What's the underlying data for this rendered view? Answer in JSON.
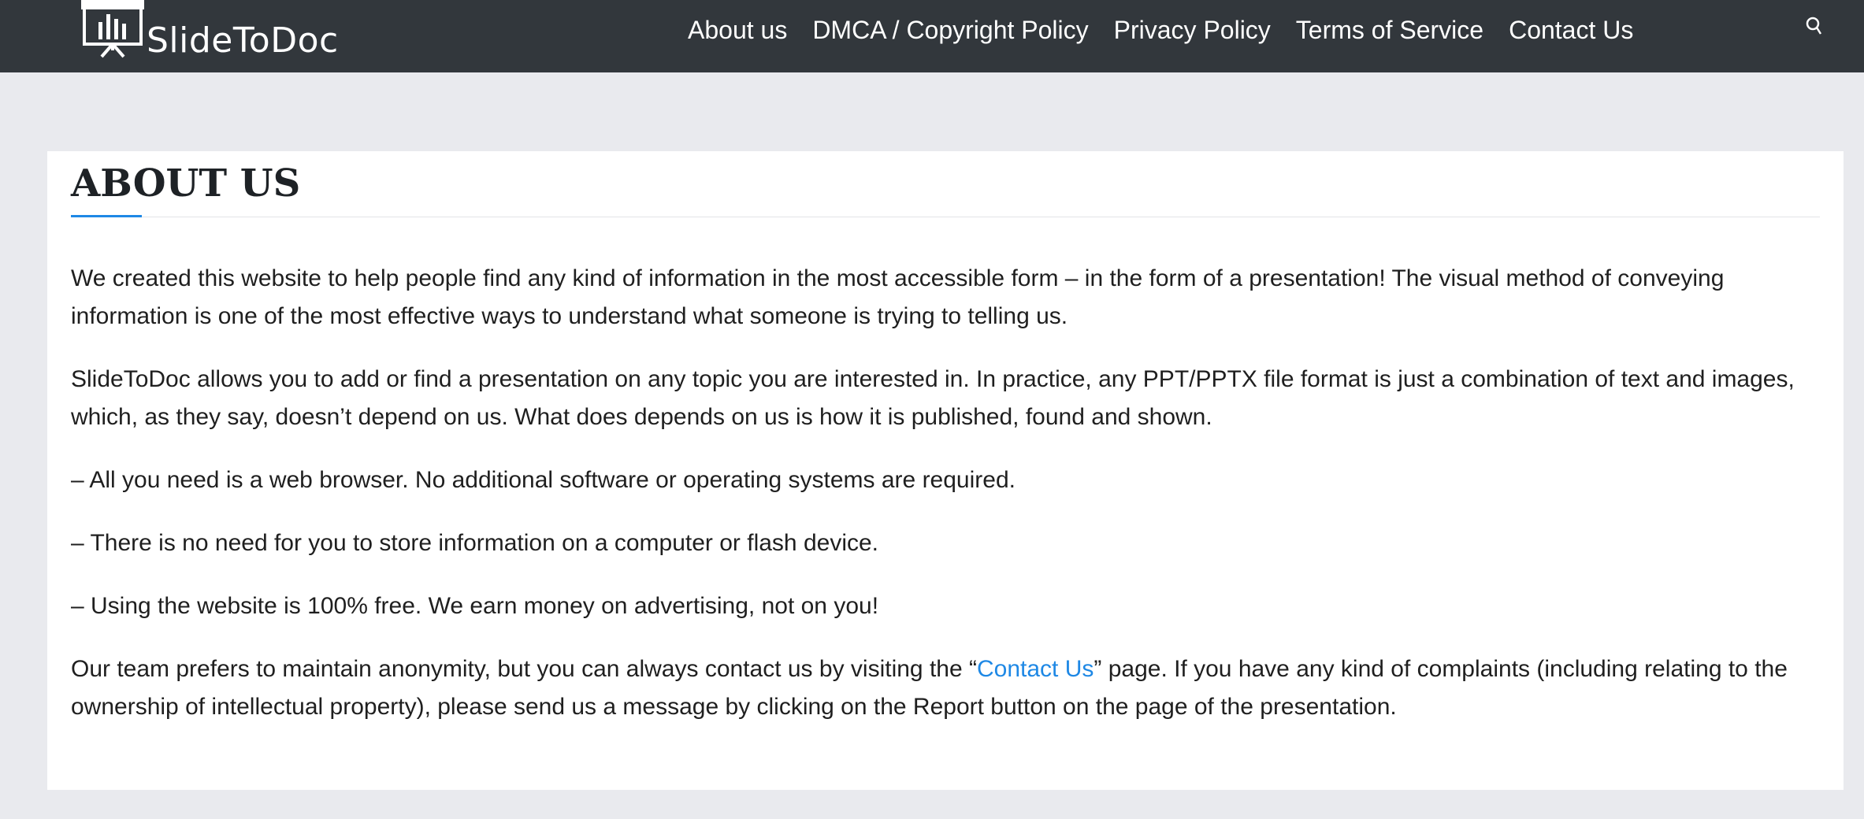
{
  "header": {
    "logo_text": "SlideToDoc",
    "nav": [
      {
        "label": "About us"
      },
      {
        "label": "DMCA / Copyright Policy"
      },
      {
        "label": "Privacy Policy"
      },
      {
        "label": "Terms of Service"
      },
      {
        "label": "Contact Us"
      }
    ],
    "search_icon": "search-icon"
  },
  "main": {
    "title": "ABOUT US",
    "p1": "We created this website to help people find any kind of information in the most accessible form – in the form of a presentation! The visual method of conveying information is one of the most effective ways to understand what someone is trying to telling us.",
    "p2": "SlideToDoc allows you to add or find a presentation on any topic you are interested in. In practice, any PPT/PPTX file format is just a combination of text and images, which, as they say, doesn’t depend on us. What does depends on us is how it is published, found and shown.",
    "bullet1": "– All you need is a web browser. No additional software or operating systems are required.",
    "bullet2": "– There is no need for you to store information on a computer or flash device.",
    "bullet3": "– Using the website is 100% free. We earn money on advertising, not on you!",
    "p3_before": "Our team prefers to maintain anonymity, but you can always contact us by visiting the “",
    "p3_link": "Contact Us",
    "p3_after": "” page. If you have any kind of complaints (including relating to the ownership of intellectual property), please send us a message by clicking on the Report button on the page of the presentation."
  },
  "colors": {
    "header_bg": "#32373c",
    "page_bg": "#e9eaee",
    "accent": "#1e88e5"
  }
}
